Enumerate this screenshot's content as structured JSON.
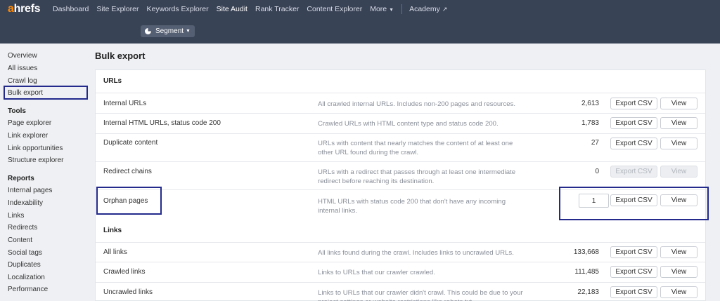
{
  "header": {
    "logo_prefix": "a",
    "logo_rest": "hrefs",
    "nav": [
      {
        "label": "Dashboard"
      },
      {
        "label": "Site Explorer"
      },
      {
        "label": "Keywords Explorer"
      },
      {
        "label": "Site Audit"
      },
      {
        "label": "Rank Tracker"
      },
      {
        "label": "Content Explorer"
      },
      {
        "label": "More"
      }
    ],
    "academy_label": "Academy",
    "segment_label": "Segment"
  },
  "sidebar": {
    "items_top": [
      "Overview",
      "All issues",
      "Crawl log",
      "Bulk export"
    ],
    "tools_heading": "Tools",
    "tools": [
      "Page explorer",
      "Link explorer",
      "Link opportunities",
      "Structure explorer"
    ],
    "reports_heading": "Reports",
    "reports": [
      "Internal pages",
      "Indexability",
      "Links",
      "Redirects",
      "Content",
      "Social tags",
      "Duplicates",
      "Localization",
      "Performance"
    ]
  },
  "main": {
    "title": "Bulk export",
    "sections": [
      {
        "title": "URLs",
        "rows": [
          {
            "name": "Internal URLs",
            "desc": "All crawled internal URLs. Includes non-200 pages and resources.",
            "count": "2,613"
          },
          {
            "name": "Internal HTML URLs, status code 200",
            "desc": "Crawled URLs with HTML content type and status code 200.",
            "count": "1,783"
          },
          {
            "name": "Duplicate content",
            "desc": "URLs with content that nearly matches the content of at least one other URL found during the crawl.",
            "count": "27"
          },
          {
            "name": "Redirect chains",
            "desc": "URLs with a redirect that passes through at least one intermediate redirect before reaching its destination.",
            "count": "0"
          },
          {
            "name": "Orphan pages",
            "desc": "HTML URLs with status code 200 that don't have any incoming internal links.",
            "count": "1"
          }
        ]
      },
      {
        "title": "Links",
        "rows": [
          {
            "name": "All links",
            "desc": "All links found during the crawl. Includes links to uncrawled URLs.",
            "count": "133,668"
          },
          {
            "name": "Crawled links",
            "desc": "Links to URLs that our crawler crawled.",
            "count": "111,485"
          },
          {
            "name": "Uncrawled links",
            "desc": "Links to URLs that our crawler didn't crawl. This could be due to your project settings or website restrictions like robots.txt",
            "count": "22,183"
          }
        ]
      }
    ],
    "export_label": "Export CSV",
    "view_label": "View"
  },
  "colors": {
    "header_bg": "#394356",
    "logo_accent": "#ff8800",
    "highlight": "#232a8c"
  }
}
